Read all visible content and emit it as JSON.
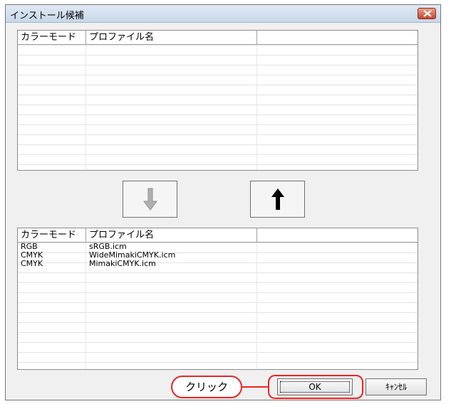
{
  "window": {
    "title": "インストール候補"
  },
  "top_list": {
    "columns": [
      "カラーモード",
      "プロファイル名",
      ""
    ],
    "rows": []
  },
  "bottom_list": {
    "columns": [
      "カラーモード",
      "プロファイル名",
      ""
    ],
    "rows": [
      {
        "mode": "RGB",
        "profile": "sRGB.icm"
      },
      {
        "mode": "CMYK",
        "profile": "WideMimakiCMYK.icm"
      },
      {
        "mode": "CMYK",
        "profile": "MimakiCMYK.icm"
      }
    ]
  },
  "buttons": {
    "move_down": "down-arrow-icon",
    "move_up": "up-arrow-icon",
    "ok": "OK",
    "cancel": "ｷｬﾝｾﾙ"
  },
  "annotation": {
    "callout": "クリック"
  },
  "colors": {
    "annotation_red": "#e22222",
    "disabled_arrow": "#9a9a9a"
  }
}
